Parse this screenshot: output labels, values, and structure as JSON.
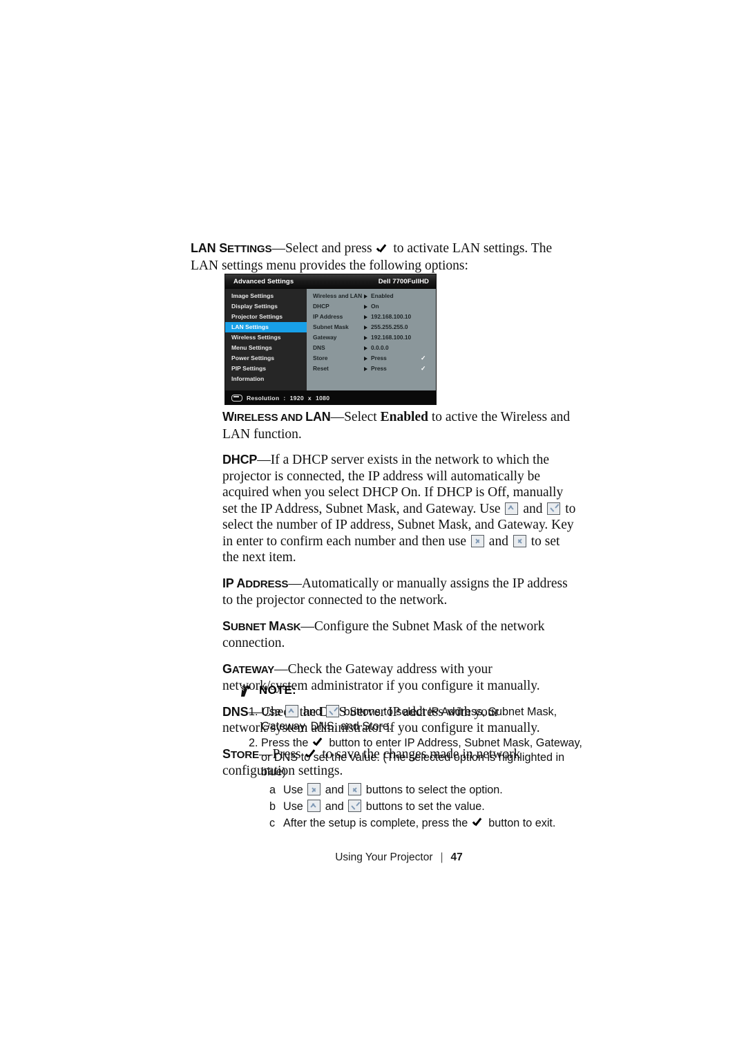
{
  "document": {
    "footer": {
      "section": "Using Your Projector",
      "separator": "|",
      "page_number": "47"
    }
  },
  "paragraphs": {
    "lan_settings": {
      "term": "LAN S",
      "term_small": "ETTINGS",
      "dash": "—",
      "text_before_check": "Select and press ",
      "text_after_check": " to activate LAN settings. The LAN settings menu provides the following options:"
    },
    "wireless_and_lan": {
      "term": "W",
      "term_small": "IRELESS AND ",
      "term2": "LAN",
      "dash": "—",
      "text_a": "Select ",
      "bold_word": "Enabled",
      "text_b": " to active the Wireless and LAN function."
    },
    "dhcp": {
      "term": "DHCP",
      "dash": "—",
      "text_a": "If a DHCP server exists in the network to which the projector is connected, the IP address will automatically be acquired when you select DHCP On. If DHCP is Off, manually set the IP Address, Subnet Mask, and Gateway. Use ",
      "text_b": " and ",
      "text_c": " to select the number of IP address, Subnet Mask, and Gateway. Key in enter to confirm each number and then use ",
      "text_d": " and ",
      "text_e": " to set the next item."
    },
    "ip_address": {
      "term": "IP A",
      "term_small": "DDRESS",
      "dash": "—",
      "text": "Automatically or manually assigns the IP address to the projector connected to the network."
    },
    "subnet_mask": {
      "term": "S",
      "term_small": "UBNET ",
      "term2": "M",
      "term2_small": "ASK",
      "dash": "—",
      "text": "Configure the Subnet Mask of the network connection."
    },
    "gateway": {
      "term": "G",
      "term_small": "ATEWAY",
      "dash": "—",
      "text": "Check the Gateway address with your network/system administrator if you configure it manually."
    },
    "dns": {
      "term": "DNS",
      "dash": "—",
      "text": "Check the DNS Server IP address with your network/system administrator if you configure it manually."
    },
    "store": {
      "term": "S",
      "term_small": "TORE",
      "dash": "—",
      "text_a": "Press ",
      "text_b": " to save the changes made in network configuration settings."
    }
  },
  "osd": {
    "header": {
      "title": "Advanced Settings",
      "model": "Dell 7700FullHD"
    },
    "nav_items": [
      {
        "label": "Image Settings",
        "active": false
      },
      {
        "label": "Display Settings",
        "active": false
      },
      {
        "label": "Projector Settings",
        "active": false
      },
      {
        "label": "LAN Settings",
        "active": true
      },
      {
        "label": "Wireless Settings",
        "active": false
      },
      {
        "label": "Menu Settings",
        "active": false
      },
      {
        "label": "Power Settings",
        "active": false
      },
      {
        "label": "PIP Settings",
        "active": false
      },
      {
        "label": "Information",
        "active": false
      }
    ],
    "rows": [
      {
        "label": "Wireless and LAN",
        "value": "Enabled",
        "check": ""
      },
      {
        "label": "DHCP",
        "value": "On",
        "check": ""
      },
      {
        "label": "IP Address",
        "value": "192.168.100.10",
        "check": ""
      },
      {
        "label": "Subnet Mask",
        "value": "255.255.255.0",
        "check": ""
      },
      {
        "label": "Gateway",
        "value": "192.168.100.10",
        "check": ""
      },
      {
        "label": "DNS",
        "value": "0.0.0.0",
        "check": ""
      },
      {
        "label": "Store",
        "value": "Press",
        "check": "✓"
      },
      {
        "label": "Reset",
        "value": "Press",
        "check": "✓"
      }
    ],
    "footer": {
      "resolution_label": "Resolution",
      "colon": ":",
      "width": "1920",
      "x": "x",
      "height": "1080"
    },
    "colors": {
      "highlight": "#18a0e8",
      "nav_bg": "#262626",
      "values_bg": "#8b979b",
      "header_bg": "#141414"
    }
  },
  "note": {
    "title": "NOTE:",
    "items": [
      {
        "num": "1.",
        "text_a": "Use ",
        "text_b": " and ",
        "text_c": " buttons to select IP Address, Subnet Mask, Gateway, DNS, and Store."
      },
      {
        "num": "2.",
        "text_a": "Press the ",
        "text_b": " button to enter IP Address, Subnet Mask, Gateway, or DNS to set the value. (The selected option is highlighted in blue)"
      }
    ],
    "sub_items": [
      {
        "num": "a",
        "text_a": "Use ",
        "text_b": " and ",
        "text_c": " buttons to select the option."
      },
      {
        "num": "b",
        "text_a": "Use ",
        "text_b": " and ",
        "text_c": " buttons to set the value."
      },
      {
        "num": "c",
        "text_a": "After the setup is complete, press the ",
        "text_b": " button to exit."
      }
    ]
  }
}
